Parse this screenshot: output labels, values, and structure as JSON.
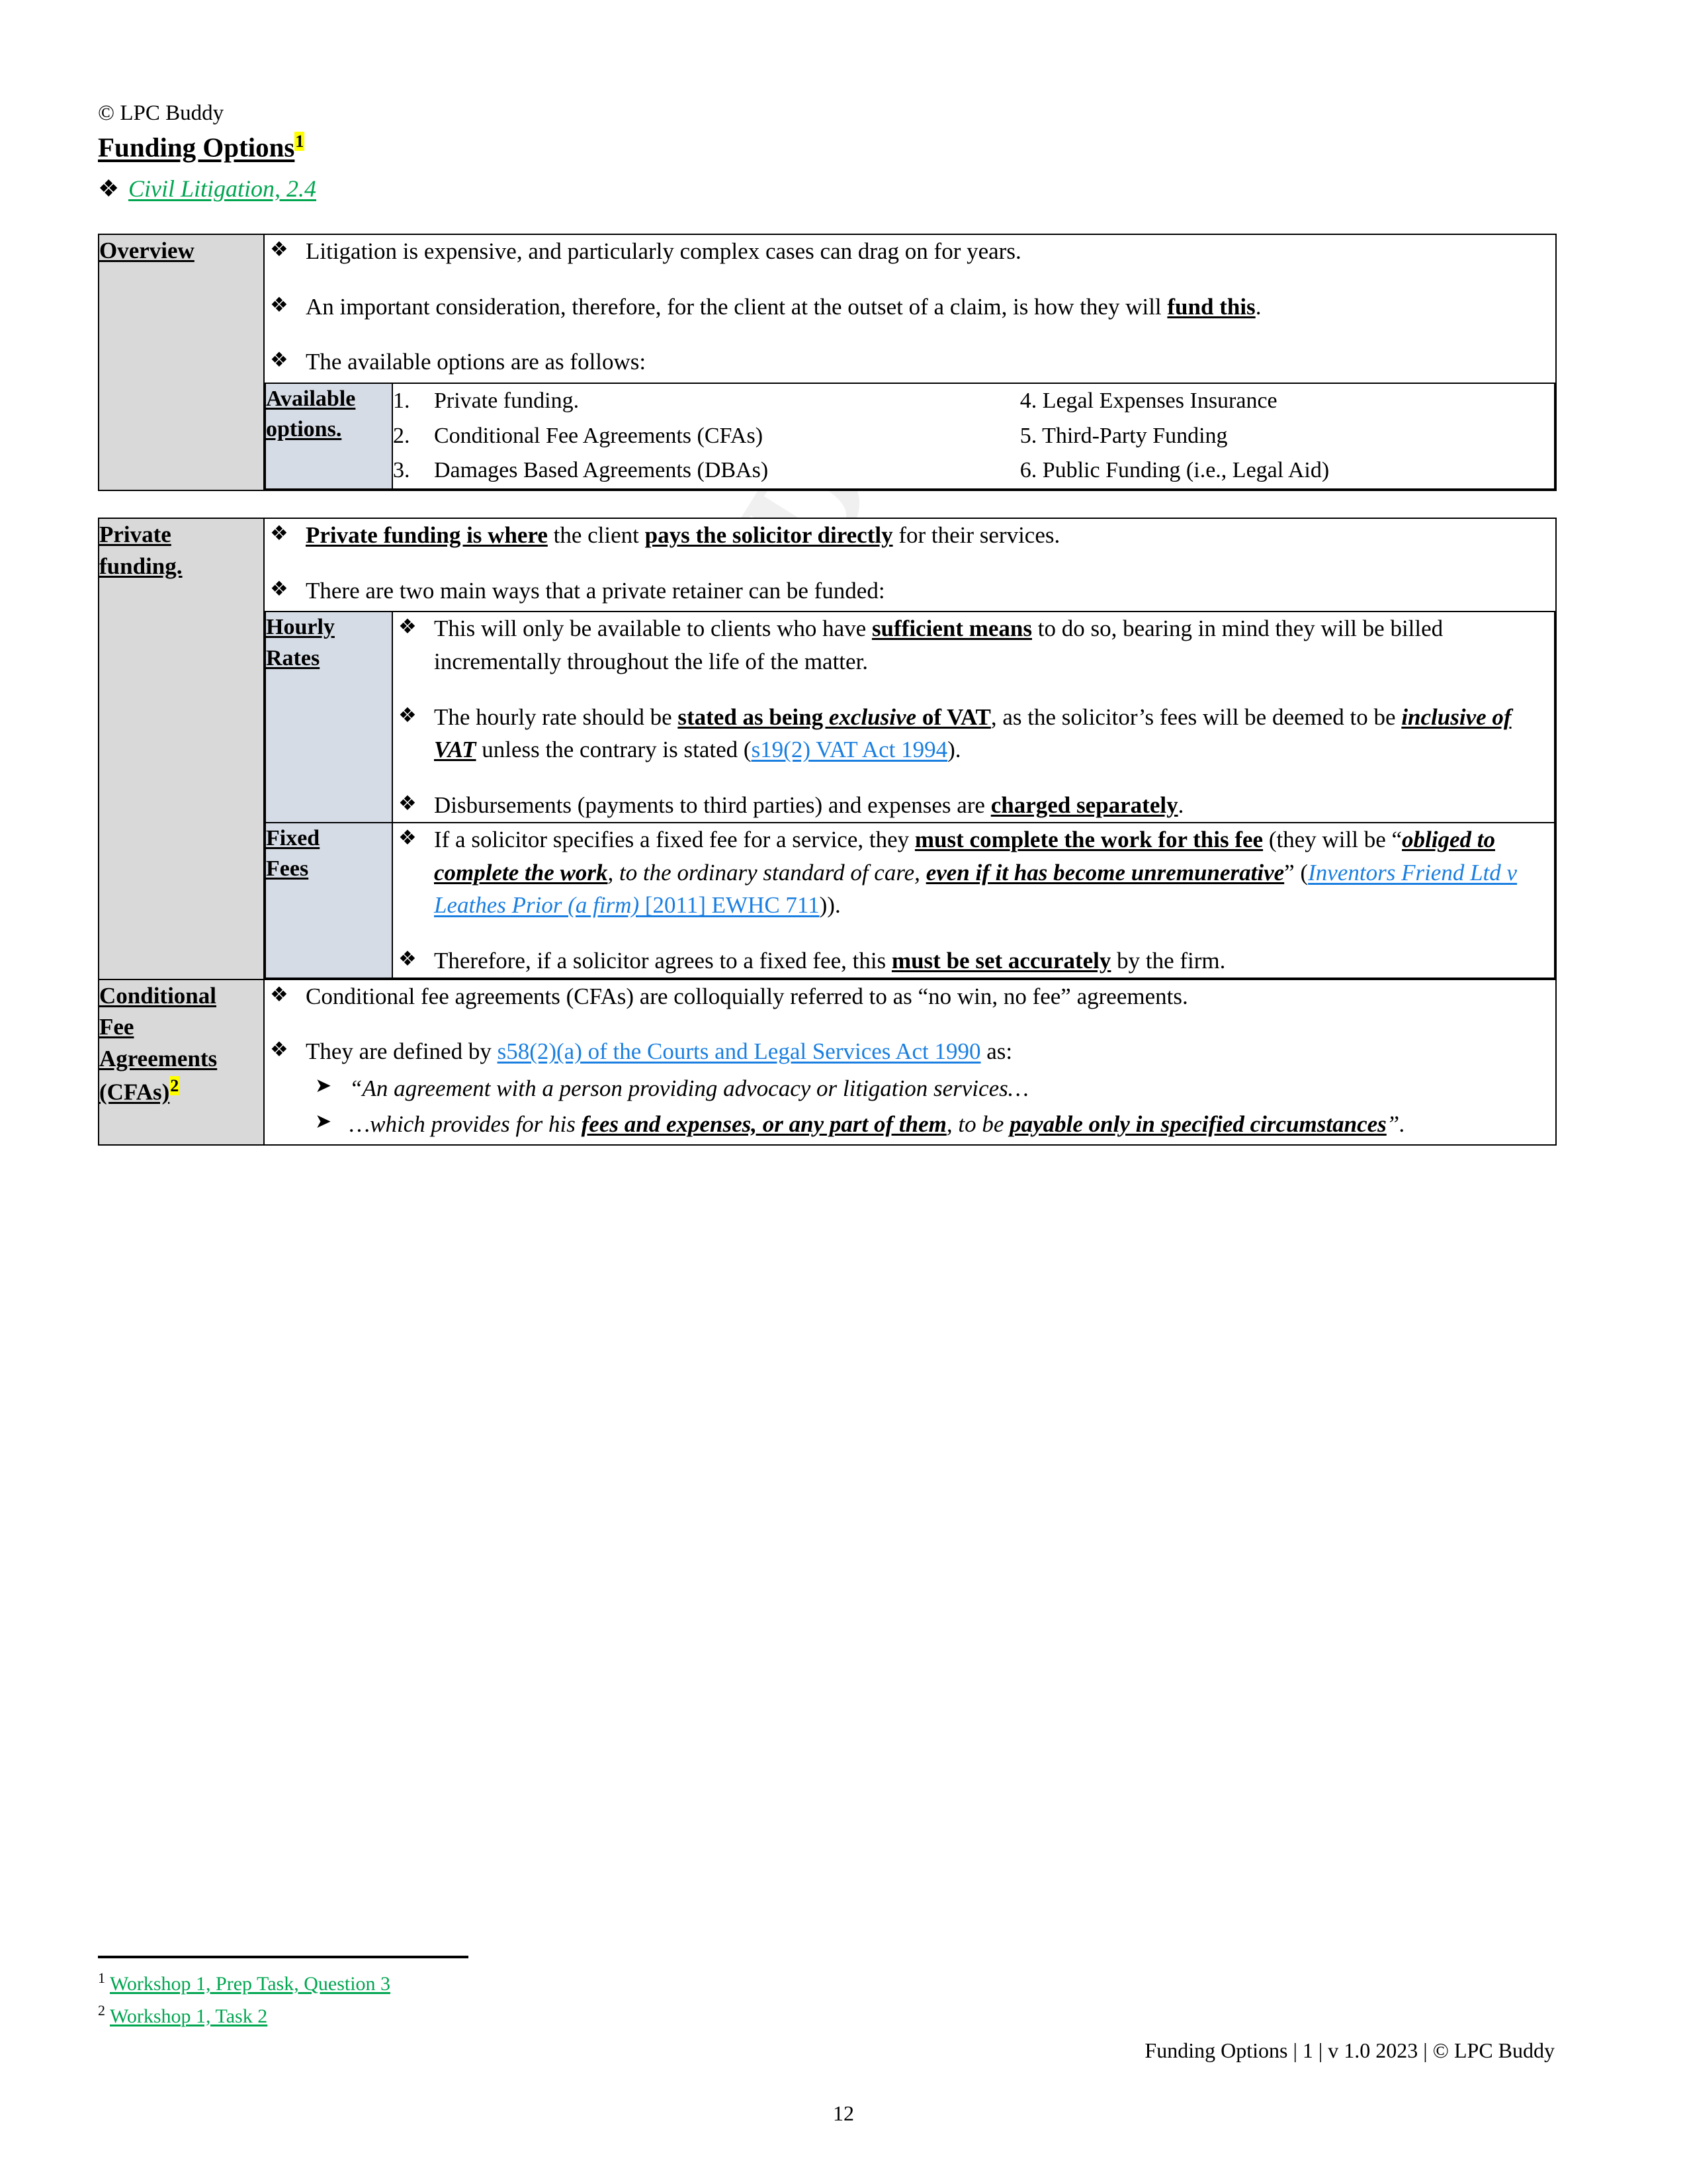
{
  "header": {
    "copyright": "© LPC Buddy",
    "title": "Funding Options",
    "title_footnote": "1",
    "subtitle_bullet": "❖",
    "subtitle": "Civil Litigation, 2.4"
  },
  "watermark": {
    "text": "LPC BUDDY"
  },
  "bullets": {
    "diamond": "❖",
    "arrow": "➤"
  },
  "overview": {
    "label": "Overview",
    "points": [
      "Litigation is expensive, and particularly complex cases can drag on for years.",
      "An important consideration, therefore, for the client at the outset of a claim, is how they will fund this.",
      "The available options are as follows:"
    ],
    "options_table": {
      "label_line1": "Available",
      "label_line2": "options.",
      "left": [
        {
          "num": "1.",
          "text": "Private funding."
        },
        {
          "num": "2.",
          "text": "Conditional Fee Agreements (CFAs)"
        },
        {
          "num": "3.",
          "text": "Damages Based Agreements (DBAs)"
        }
      ],
      "right": [
        "4. Legal Expenses Insurance",
        "5. Third-Party Funding",
        "6. Public Funding (i.e., Legal Aid)"
      ]
    }
  },
  "private_funding": {
    "label_line1": "Private",
    "label_line2": "funding.",
    "point1": {
      "bold_lead": "Private funding is where",
      "mid": " the client ",
      "bold_mid": "pays the solicitor directly",
      "tail": " for their services."
    },
    "point2": "There are two main ways that a private retainer can be funded:",
    "hourly": {
      "label_line1": "Hourly",
      "label_line2": "Rates",
      "p1_a": "This will only be available to clients who have ",
      "p1_bold": "sufficient means",
      "p1_b": " to do so, bearing in mind they will be billed incrementally throughout the life of the matter.",
      "p2_a": "The hourly rate should be ",
      "p2_bold1": "stated as being ",
      "p2_bolditalic1": "exclusive",
      "p2_bold2": " of VAT",
      "p2_b": ", as the solicitor’s fees will be deemed to be ",
      "p2_bolditalic2": "inclusive of VAT",
      "p2_c": " unless the contrary is stated (",
      "p2_link": "s19(2) VAT Act 1994",
      "p2_d": ").",
      "p3_a": "Disbursements (payments to third parties) and expenses are ",
      "p3_bold": "charged separately",
      "p3_b": "."
    },
    "fixed": {
      "label_line1": "Fixed",
      "label_line2": "Fees",
      "p1_a": "If a solicitor specifies a fixed fee for a service, they ",
      "p1_bold1": "must complete the work for this fee",
      "p1_b": " (they will be “",
      "p1_bolditalic1": "obliged to complete the work",
      "p1_italic1": ", to the ordinary standard of care, ",
      "p1_bolditalic2": "even if it has become unremunerative",
      "p1_c": "” (",
      "p1_link_italic": "Inventors Friend Ltd v Leathes Prior (a firm)",
      "p1_link_plain": " [2011] EWHC 711",
      "p1_d": ")).",
      "p2_a": "Therefore, if a solicitor agrees to a fixed fee, this ",
      "p2_bold": "must be set accurately",
      "p2_b": " by the firm."
    }
  },
  "cfa": {
    "label_line1": "Conditional",
    "label_line2": "Fee",
    "label_line3": "Agreements",
    "label_line4": "(CFAs)",
    "label_footnote": "2",
    "point1": "Conditional fee agreements (CFAs) are colloquially referred to as “no win, no fee” agreements.",
    "point2_a": "They are defined by ",
    "point2_link": "s58(2)(a) of the Courts and Legal Services Act 1990",
    "point2_b": " as:",
    "quote1": "“An agreement with a person providing advocacy or litigation services…",
    "quote2_a": "…which provides for his ",
    "quote2_bold1": "fees and expenses, or any part of them",
    "quote2_b": ", to be ",
    "quote2_bold2": "payable only in specified circumstances",
    "quote2_c": "”."
  },
  "footnotes": [
    {
      "num": "1",
      "text": "Workshop 1, Prep Task, Question 3"
    },
    {
      "num": "2",
      "text": "Workshop 1, Task 2"
    }
  ],
  "footer": {
    "right": "Funding Options | 1 | v 1.0 2023 | © LPC Buddy",
    "page_number": "12"
  },
  "colors": {
    "green_link": "#00a550",
    "blue_link": "#1a7fe0",
    "highlight": "#ffff00",
    "label_gray": "#d9d9d9",
    "nested_label_blue": "#d6dce5"
  }
}
